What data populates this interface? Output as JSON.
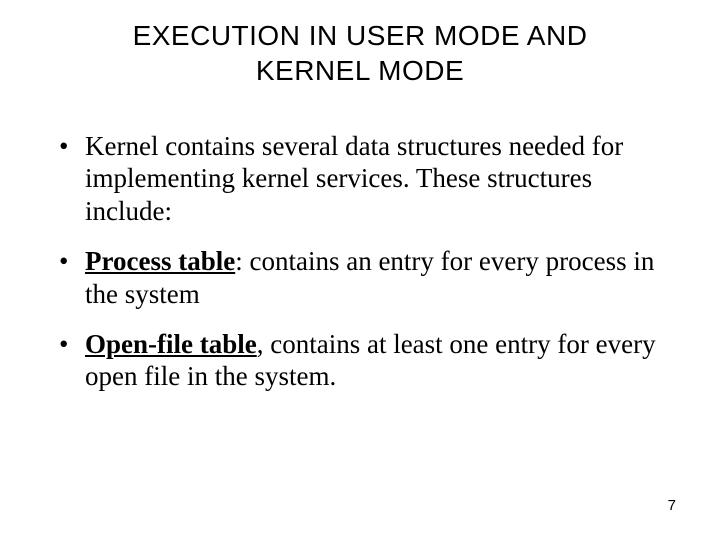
{
  "title_line1": "EXECUTION IN USER MODE AND",
  "title_line2": "KERNEL MODE",
  "bullets": [
    {
      "bold": null,
      "text": "Kernel contains several data structures needed for implementing kernel services. These structures include:"
    },
    {
      "bold": "Process table",
      "sep": ": ",
      "text": "contains an entry for every process in the system"
    },
    {
      "bold": "Open-file table",
      "sep": ", ",
      "text": "contains at least one entry for every open file in the system."
    }
  ],
  "page_number": "7"
}
